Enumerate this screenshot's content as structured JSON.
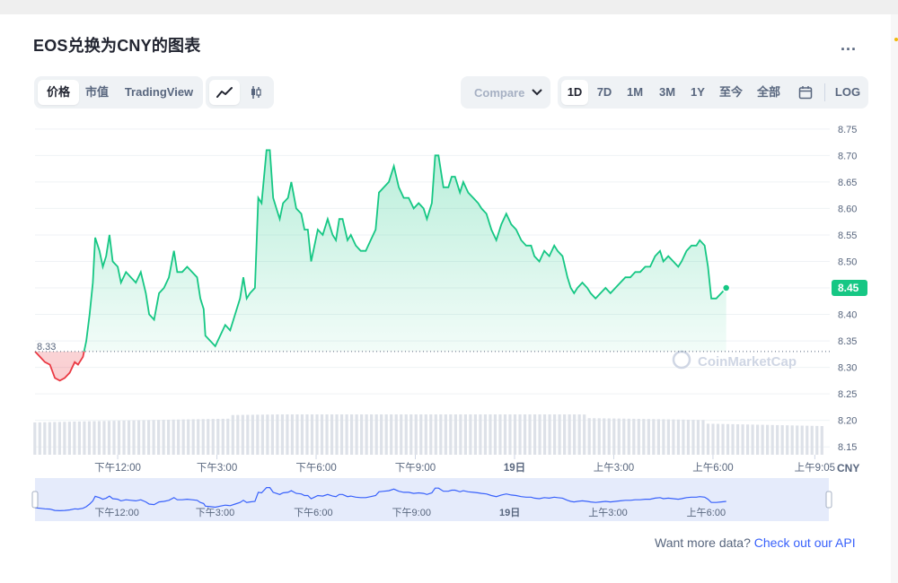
{
  "title": "EOS兑换为CNY的图表",
  "more_label": "...",
  "view_tabs": [
    {
      "label": "价格",
      "active": true
    },
    {
      "label": "市值",
      "active": false
    },
    {
      "label": "TradingView",
      "active": false
    }
  ],
  "chart_style_icons": [
    "line-chart-icon",
    "candlestick-icon"
  ],
  "compare_label": "Compare",
  "range_tabs": [
    {
      "label": "1D",
      "active": true
    },
    {
      "label": "7D",
      "active": false
    },
    {
      "label": "1M",
      "active": false
    },
    {
      "label": "3M",
      "active": false
    },
    {
      "label": "1Y",
      "active": false
    },
    {
      "label": "至今",
      "active": false
    },
    {
      "label": "全部",
      "active": false
    }
  ],
  "log_label": "LOG",
  "watermark": "CoinMarketCap",
  "currency_label": "CNY",
  "footer": {
    "text": "Want more data?",
    "link": "Check out our API"
  },
  "colors": {
    "up": "#16c784",
    "down": "#ea3943",
    "accent": "#3861fb"
  },
  "chart_data": {
    "type": "area",
    "ylim": [
      8.13,
      8.77
    ],
    "y_ticks": [
      "8.75",
      "8.70",
      "8.65",
      "8.60",
      "8.55",
      "8.50",
      "8.45",
      "8.40",
      "8.35",
      "8.30",
      "8.25",
      "8.20",
      "8.15"
    ],
    "x_ticks": [
      {
        "label": "下午12:00",
        "t": 2.0
      },
      {
        "label": "下午3:00",
        "t": 5.0
      },
      {
        "label": "下午6:00",
        "t": 8.0
      },
      {
        "label": "下午9:00",
        "t": 11.0
      },
      {
        "label": "19日",
        "t": 14.0
      },
      {
        "label": "上午3:00",
        "t": 17.0
      },
      {
        "label": "上午6:00",
        "t": 20.0
      },
      {
        "label": "上午9:05",
        "t": 23.08
      }
    ],
    "navigator_ticks": [
      "下午12:00",
      "下午3:00",
      "下午6:00",
      "下午9:00",
      "19日",
      "上午3:00",
      "上午6:00"
    ],
    "open_price": 8.33,
    "open_label": "8.33",
    "current_price": 8.45,
    "current_label": "8.45",
    "t_range": [
      -0.5,
      23.45
    ],
    "series": [
      [
        -0.5,
        8.33
      ],
      [
        -0.35,
        8.32
      ],
      [
        -0.2,
        8.31
      ],
      [
        -0.05,
        8.305
      ],
      [
        0.1,
        8.28
      ],
      [
        0.25,
        8.275
      ],
      [
        0.4,
        8.28
      ],
      [
        0.55,
        8.29
      ],
      [
        0.7,
        8.31
      ],
      [
        0.8,
        8.305
      ],
      [
        0.95,
        8.32
      ],
      [
        1.05,
        8.35
      ],
      [
        1.15,
        8.4
      ],
      [
        1.25,
        8.46
      ],
      [
        1.32,
        8.545
      ],
      [
        1.45,
        8.52
      ],
      [
        1.55,
        8.49
      ],
      [
        1.65,
        8.51
      ],
      [
        1.75,
        8.55
      ],
      [
        1.85,
        8.5
      ],
      [
        2.0,
        8.49
      ],
      [
        2.1,
        8.46
      ],
      [
        2.25,
        8.48
      ],
      [
        2.4,
        8.47
      ],
      [
        2.55,
        8.46
      ],
      [
        2.7,
        8.48
      ],
      [
        2.85,
        8.44
      ],
      [
        2.95,
        8.4
      ],
      [
        3.1,
        8.39
      ],
      [
        3.25,
        8.44
      ],
      [
        3.4,
        8.45
      ],
      [
        3.55,
        8.47
      ],
      [
        3.7,
        8.52
      ],
      [
        3.8,
        8.48
      ],
      [
        3.95,
        8.48
      ],
      [
        4.1,
        8.49
      ],
      [
        4.25,
        8.48
      ],
      [
        4.4,
        8.47
      ],
      [
        4.5,
        8.43
      ],
      [
        4.6,
        8.41
      ],
      [
        4.65,
        8.36
      ],
      [
        4.8,
        8.35
      ],
      [
        4.95,
        8.34
      ],
      [
        5.1,
        8.36
      ],
      [
        5.25,
        8.38
      ],
      [
        5.4,
        8.37
      ],
      [
        5.55,
        8.4
      ],
      [
        5.7,
        8.43
      ],
      [
        5.8,
        8.47
      ],
      [
        5.9,
        8.43
      ],
      [
        6.0,
        8.44
      ],
      [
        6.15,
        8.45
      ],
      [
        6.25,
        8.62
      ],
      [
        6.35,
        8.61
      ],
      [
        6.5,
        8.71
      ],
      [
        6.6,
        8.71
      ],
      [
        6.7,
        8.62
      ],
      [
        6.8,
        8.6
      ],
      [
        6.9,
        8.58
      ],
      [
        7.0,
        8.61
      ],
      [
        7.15,
        8.62
      ],
      [
        7.25,
        8.65
      ],
      [
        7.4,
        8.6
      ],
      [
        7.55,
        8.59
      ],
      [
        7.65,
        8.56
      ],
      [
        7.75,
        8.56
      ],
      [
        7.85,
        8.5
      ],
      [
        7.95,
        8.53
      ],
      [
        8.05,
        8.56
      ],
      [
        8.2,
        8.55
      ],
      [
        8.35,
        8.58
      ],
      [
        8.5,
        8.55
      ],
      [
        8.6,
        8.54
      ],
      [
        8.7,
        8.58
      ],
      [
        8.8,
        8.58
      ],
      [
        8.95,
        8.54
      ],
      [
        9.05,
        8.55
      ],
      [
        9.2,
        8.53
      ],
      [
        9.35,
        8.52
      ],
      [
        9.5,
        8.52
      ],
      [
        9.65,
        8.54
      ],
      [
        9.8,
        8.56
      ],
      [
        9.9,
        8.63
      ],
      [
        10.05,
        8.64
      ],
      [
        10.2,
        8.65
      ],
      [
        10.35,
        8.68
      ],
      [
        10.5,
        8.64
      ],
      [
        10.65,
        8.62
      ],
      [
        10.8,
        8.62
      ],
      [
        10.95,
        8.6
      ],
      [
        11.1,
        8.61
      ],
      [
        11.25,
        8.6
      ],
      [
        11.35,
        8.58
      ],
      [
        11.5,
        8.61
      ],
      [
        11.6,
        8.7
      ],
      [
        11.7,
        8.7
      ],
      [
        11.85,
        8.64
      ],
      [
        12.0,
        8.64
      ],
      [
        12.1,
        8.66
      ],
      [
        12.2,
        8.66
      ],
      [
        12.35,
        8.63
      ],
      [
        12.45,
        8.65
      ],
      [
        12.6,
        8.63
      ],
      [
        12.75,
        8.62
      ],
      [
        12.9,
        8.61
      ],
      [
        13.0,
        8.6
      ],
      [
        13.15,
        8.59
      ],
      [
        13.3,
        8.56
      ],
      [
        13.45,
        8.54
      ],
      [
        13.6,
        8.57
      ],
      [
        13.75,
        8.59
      ],
      [
        13.9,
        8.57
      ],
      [
        14.05,
        8.56
      ],
      [
        14.2,
        8.54
      ],
      [
        14.35,
        8.53
      ],
      [
        14.5,
        8.53
      ],
      [
        14.6,
        8.51
      ],
      [
        14.75,
        8.5
      ],
      [
        14.9,
        8.52
      ],
      [
        15.05,
        8.51
      ],
      [
        15.2,
        8.53
      ],
      [
        15.3,
        8.52
      ],
      [
        15.45,
        8.51
      ],
      [
        15.6,
        8.47
      ],
      [
        15.7,
        8.45
      ],
      [
        15.8,
        8.44
      ],
      [
        15.9,
        8.45
      ],
      [
        16.05,
        8.46
      ],
      [
        16.2,
        8.45
      ],
      [
        16.3,
        8.44
      ],
      [
        16.45,
        8.43
      ],
      [
        16.6,
        8.44
      ],
      [
        16.75,
        8.45
      ],
      [
        16.9,
        8.44
      ],
      [
        17.05,
        8.45
      ],
      [
        17.2,
        8.46
      ],
      [
        17.35,
        8.47
      ],
      [
        17.5,
        8.47
      ],
      [
        17.65,
        8.48
      ],
      [
        17.8,
        8.48
      ],
      [
        17.95,
        8.49
      ],
      [
        18.1,
        8.49
      ],
      [
        18.25,
        8.51
      ],
      [
        18.4,
        8.52
      ],
      [
        18.5,
        8.5
      ],
      [
        18.65,
        8.51
      ],
      [
        18.8,
        8.5
      ],
      [
        18.95,
        8.49
      ],
      [
        19.05,
        8.5
      ],
      [
        19.2,
        8.52
      ],
      [
        19.35,
        8.53
      ],
      [
        19.5,
        8.53
      ],
      [
        19.6,
        8.54
      ],
      [
        19.75,
        8.53
      ],
      [
        19.85,
        8.49
      ],
      [
        19.95,
        8.43
      ],
      [
        20.1,
        8.43
      ],
      [
        20.25,
        8.44
      ],
      [
        20.4,
        8.45
      ]
    ],
    "volume": {
      "t_start": -0.5,
      "t_end": 23.3,
      "bar_count": 160,
      "max_height": 45
    }
  }
}
